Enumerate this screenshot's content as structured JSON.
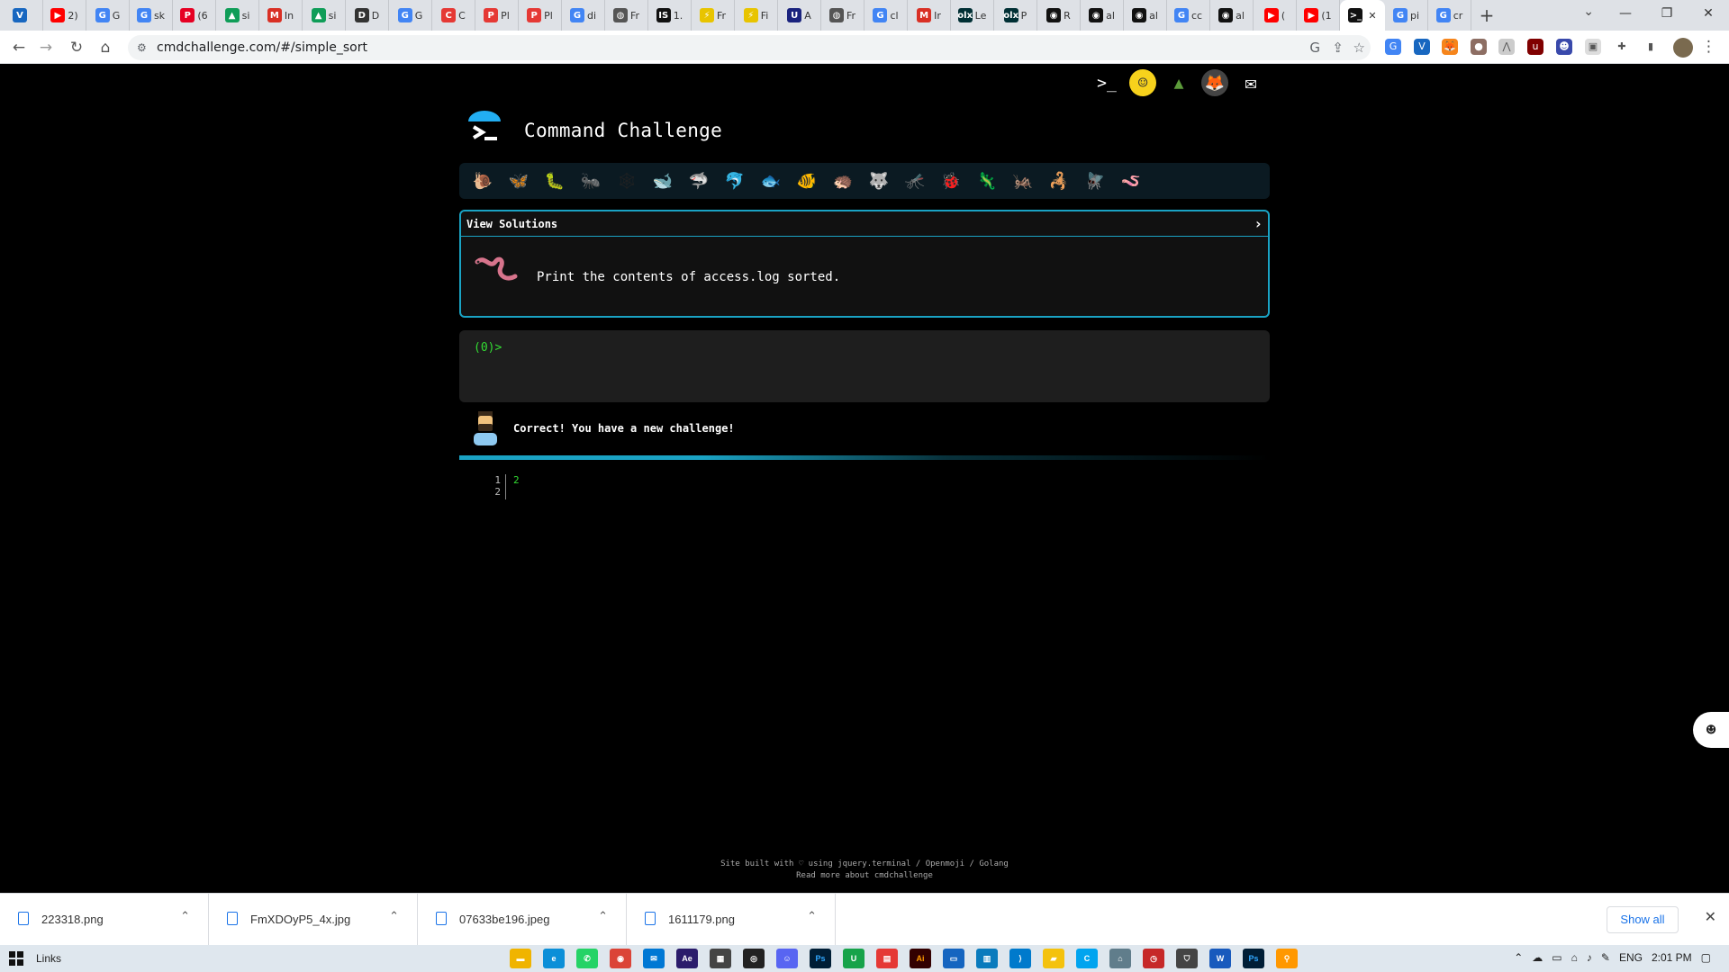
{
  "browser": {
    "tabs": [
      {
        "label": "",
        "icon": "vuetify-icon",
        "color": "#1867c0",
        "glyph": "V"
      },
      {
        "label": "2)",
        "icon": "youtube-icon",
        "color": "#ff0000",
        "glyph": "▶"
      },
      {
        "label": "G",
        "icon": "translate-icon",
        "color": "#4285f4",
        "glyph": "G"
      },
      {
        "label": "sk",
        "icon": "google-icon",
        "color": "#4285f4",
        "glyph": "G"
      },
      {
        "label": "(6",
        "icon": "pinterest-icon",
        "color": "#e60023",
        "glyph": "P"
      },
      {
        "label": "si",
        "icon": "drive-icon",
        "color": "#0f9d58",
        "glyph": "▲"
      },
      {
        "label": "In",
        "icon": "gmail-icon",
        "color": "#d93025",
        "glyph": "M"
      },
      {
        "label": "si",
        "icon": "drive-icon",
        "color": "#0f9d58",
        "glyph": "▲"
      },
      {
        "label": "D",
        "icon": "doc-icon",
        "color": "#333333",
        "glyph": "D"
      },
      {
        "label": "G",
        "icon": "translate-icon",
        "color": "#4285f4",
        "glyph": "G"
      },
      {
        "label": "C",
        "icon": "pdf-icon",
        "color": "#e53935",
        "glyph": "C"
      },
      {
        "label": "Pl",
        "icon": "pdf-icon",
        "color": "#e53935",
        "glyph": "P"
      },
      {
        "label": "Pl",
        "icon": "pdf-icon",
        "color": "#e53935",
        "glyph": "P"
      },
      {
        "label": "di",
        "icon": "google-icon",
        "color": "#4285f4",
        "glyph": "G"
      },
      {
        "label": "Fr",
        "icon": "globe-icon",
        "color": "#555555",
        "glyph": "◍"
      },
      {
        "label": "1.",
        "icon": "is-icon",
        "color": "#111111",
        "glyph": "IS"
      },
      {
        "label": "Fr",
        "icon": "lightning-icon",
        "color": "#e8c400",
        "glyph": "⚡"
      },
      {
        "label": "Fi",
        "icon": "lightning-icon",
        "color": "#e8c400",
        "glyph": "⚡"
      },
      {
        "label": "A",
        "icon": "u-icon",
        "color": "#1a237e",
        "glyph": "U"
      },
      {
        "label": "Fr",
        "icon": "globe-icon",
        "color": "#555555",
        "glyph": "◍"
      },
      {
        "label": "cl",
        "icon": "google-icon",
        "color": "#4285f4",
        "glyph": "G"
      },
      {
        "label": "Ir",
        "icon": "gmail-icon",
        "color": "#d93025",
        "glyph": "M"
      },
      {
        "label": "Le",
        "icon": "olx-icon",
        "color": "#002f34",
        "glyph": "olx"
      },
      {
        "label": "P",
        "icon": "olx-icon",
        "color": "#002f34",
        "glyph": "olx"
      },
      {
        "label": "R",
        "icon": "github-icon",
        "color": "#111111",
        "glyph": "◉"
      },
      {
        "label": "al",
        "icon": "github-icon",
        "color": "#111111",
        "glyph": "◉"
      },
      {
        "label": "al",
        "icon": "github-icon",
        "color": "#111111",
        "glyph": "◉"
      },
      {
        "label": "cc",
        "icon": "google-icon",
        "color": "#4285f4",
        "glyph": "G"
      },
      {
        "label": "al",
        "icon": "github-icon",
        "color": "#111111",
        "glyph": "◉"
      },
      {
        "label": "(",
        "icon": "youtube-icon",
        "color": "#ff0000",
        "glyph": "▶"
      },
      {
        "label": "(1",
        "icon": "youtube-icon",
        "color": "#ff0000",
        "glyph": "▶"
      },
      {
        "label": "",
        "icon": "terminal-icon",
        "color": "#111111",
        "glyph": ">_",
        "active": true
      },
      {
        "label": "pi",
        "icon": "google-icon",
        "color": "#4285f4",
        "glyph": "G"
      },
      {
        "label": "cr",
        "icon": "google-icon",
        "color": "#4285f4",
        "glyph": "G"
      }
    ],
    "url": "cmdchallenge.com/#/simple_sort"
  },
  "page": {
    "title": "Command Challenge",
    "view_solutions_label": "View Solutions",
    "challenge_text": "Print the contents of access.log sorted.",
    "prompt": "(0)>",
    "feedback": "Correct! You have a new challenge!",
    "editor": {
      "line1": "1",
      "line2": "2",
      "code": "2"
    },
    "footer_line1": "Site built with ♡ using jquery.terminal / Openmoji / Golang",
    "footer_line2": "Read more about cmdchallenge",
    "bugs": [
      {
        "name": "snail-icon",
        "glyph": "🐌"
      },
      {
        "name": "butterfly-icon",
        "glyph": "🦋"
      },
      {
        "name": "caterpillar-icon",
        "glyph": "🐛"
      },
      {
        "name": "ant-icon",
        "glyph": "🐜"
      },
      {
        "name": "spider-web-icon",
        "glyph": "🕸"
      },
      {
        "name": "whale-icon",
        "glyph": "🐋"
      },
      {
        "name": "shark-icon",
        "glyph": "🦈"
      },
      {
        "name": "dolphin-icon",
        "glyph": "🐬"
      },
      {
        "name": "fish-icon",
        "glyph": "🐟"
      },
      {
        "name": "tropical-fish-icon",
        "glyph": "🐠"
      },
      {
        "name": "hedgehog-icon",
        "glyph": "🦔"
      },
      {
        "name": "wolf-icon",
        "glyph": "🐺"
      },
      {
        "name": "mosquito-icon",
        "glyph": "🦟"
      },
      {
        "name": "ladybug-icon",
        "glyph": "🐞"
      },
      {
        "name": "lizard-icon",
        "glyph": "🦎"
      },
      {
        "name": "cricket-icon",
        "glyph": "🦗"
      },
      {
        "name": "scorpion-icon",
        "glyph": "🦂"
      },
      {
        "name": "fly-icon",
        "glyph": "🪰"
      },
      {
        "name": "worm-icon",
        "glyph": "🪱"
      }
    ]
  },
  "downloads": {
    "items": [
      "223318.png",
      "FmXDOyP5_4x.jpg",
      "07633be196.jpeg",
      "1611179.png"
    ],
    "show_all": "Show all"
  },
  "taskbar": {
    "links": "Links",
    "lang": "ENG",
    "time": "2:01 PM"
  }
}
